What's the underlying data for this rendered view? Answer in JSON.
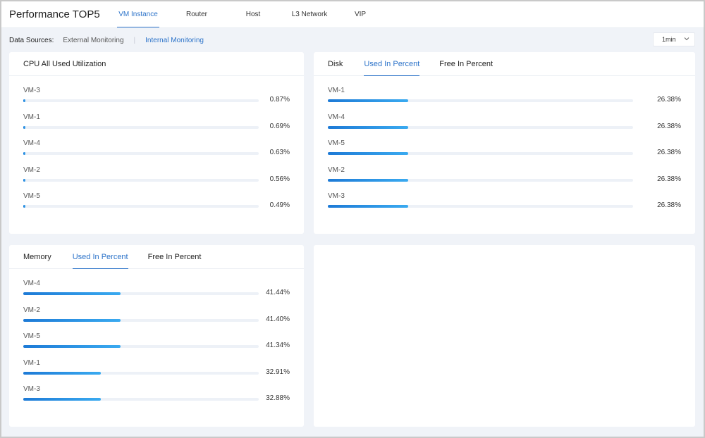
{
  "header": {
    "title": "Performance TOP5",
    "tabs": [
      {
        "label": "VM Instance",
        "active": true
      },
      {
        "label": "Router",
        "active": false
      },
      {
        "label": "Host",
        "active": false
      },
      {
        "label": "L3 Network",
        "active": false
      },
      {
        "label": "VIP",
        "active": false
      }
    ]
  },
  "sources": {
    "label": "Data Sources:",
    "items": [
      {
        "label": "External Monitoring",
        "active": false
      },
      {
        "label": "Internal Monitoring",
        "active": true
      }
    ],
    "separator": "|"
  },
  "interval": {
    "value": "1min",
    "icon": "chevron-down-icon"
  },
  "cpu": {
    "title": "CPU All Used Utilization",
    "rows": [
      {
        "name": "VM-3",
        "value": "0.87%",
        "percent": 0.87
      },
      {
        "name": "VM-1",
        "value": "0.69%",
        "percent": 0.69
      },
      {
        "name": "VM-4",
        "value": "0.63%",
        "percent": 0.63
      },
      {
        "name": "VM-2",
        "value": "0.56%",
        "percent": 0.56
      },
      {
        "name": "VM-5",
        "value": "0.49%",
        "percent": 0.49
      }
    ]
  },
  "disk": {
    "title": "Disk",
    "tabs": [
      {
        "label": "Used In Percent",
        "active": true
      },
      {
        "label": "Free In Percent",
        "active": false
      }
    ],
    "rows": [
      {
        "name": "VM-1",
        "value": "26.38%",
        "percent": 26.38
      },
      {
        "name": "VM-4",
        "value": "26.38%",
        "percent": 26.38
      },
      {
        "name": "VM-5",
        "value": "26.38%",
        "percent": 26.38
      },
      {
        "name": "VM-2",
        "value": "26.38%",
        "percent": 26.38
      },
      {
        "name": "VM-3",
        "value": "26.38%",
        "percent": 26.38
      }
    ]
  },
  "memory": {
    "title": "Memory",
    "tabs": [
      {
        "label": "Used In Percent",
        "active": true
      },
      {
        "label": "Free In Percent",
        "active": false
      }
    ],
    "rows": [
      {
        "name": "VM-4",
        "value": "41.44%",
        "percent": 41.44
      },
      {
        "name": "VM-2",
        "value": "41.40%",
        "percent": 41.4
      },
      {
        "name": "VM-5",
        "value": "41.34%",
        "percent": 41.34
      },
      {
        "name": "VM-1",
        "value": "32.91%",
        "percent": 32.91
      },
      {
        "name": "VM-3",
        "value": "32.88%",
        "percent": 32.88
      }
    ]
  },
  "colors": {
    "accent": "#2c73c9",
    "bar_start": "#1d7ad6",
    "bar_end": "#3aaaf0",
    "track": "#edf1f7"
  }
}
